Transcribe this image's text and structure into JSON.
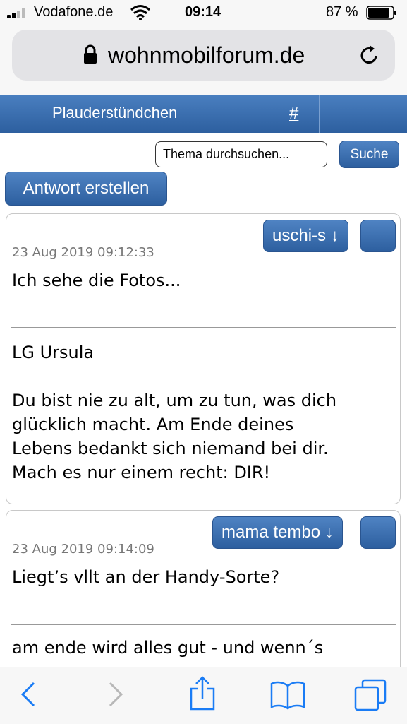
{
  "status_bar": {
    "carrier": "Vodafone.de",
    "time": "09:14",
    "battery_percent": "87 %",
    "battery_level": 0.87
  },
  "browser": {
    "url": "wohnmobilforum.de"
  },
  "site_nav": {
    "title": "Plauderstündchen",
    "hash_link": "#"
  },
  "search": {
    "placeholder": "Thema durchsuchen...",
    "button_label": "Suche"
  },
  "reply_button_label": "Antwort erstellen",
  "posts": [
    {
      "author": "uschi-s ↓",
      "date": "23 Aug 2019 09:12:33",
      "text": "Ich sehe die Fotos...",
      "signature": [
        "LG Ursula",
        "",
        "Du bist nie zu alt, um zu tun, was dich",
        "glücklich macht. Am Ende deines",
        "Lebens bedankt sich niemand bei dir.",
        "Mach es nur einem recht: DIR!"
      ]
    },
    {
      "author": "mama tembo ↓",
      "date": "23 Aug 2019 09:14:09",
      "text": "Liegt’s vllt an der Handy-Sorte?",
      "signature": [
        "am ende wird alles gut - und wenn´s"
      ]
    }
  ],
  "colors": {
    "accent_blue": "#2d5f9f",
    "ios_blue": "#1a7cf5"
  }
}
